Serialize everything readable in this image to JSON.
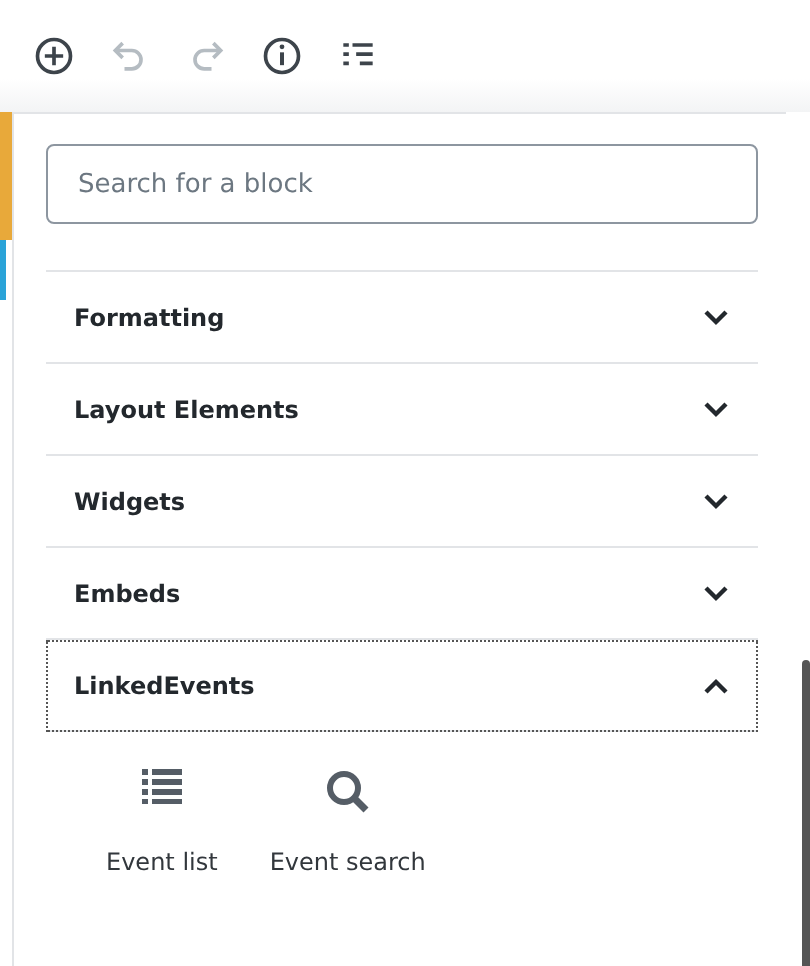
{
  "toolbar": [
    {
      "kind": "add",
      "disabled": false
    },
    {
      "kind": "undo",
      "disabled": true
    },
    {
      "kind": "redo",
      "disabled": true
    },
    {
      "kind": "info",
      "disabled": false
    },
    {
      "kind": "outline",
      "disabled": false
    }
  ],
  "search": {
    "placeholder": "Search for a block"
  },
  "panels": [
    {
      "title": "Formatting",
      "expanded": false,
      "focused": false
    },
    {
      "title": "Layout Elements",
      "expanded": false,
      "focused": false
    },
    {
      "title": "Widgets",
      "expanded": false,
      "focused": false
    },
    {
      "title": "Embeds",
      "expanded": false,
      "focused": false
    },
    {
      "title": "LinkedEvents",
      "expanded": true,
      "focused": true,
      "blocks": [
        {
          "label": "Event list",
          "kind": "list"
        },
        {
          "label": "Event search",
          "kind": "search"
        }
      ]
    }
  ]
}
